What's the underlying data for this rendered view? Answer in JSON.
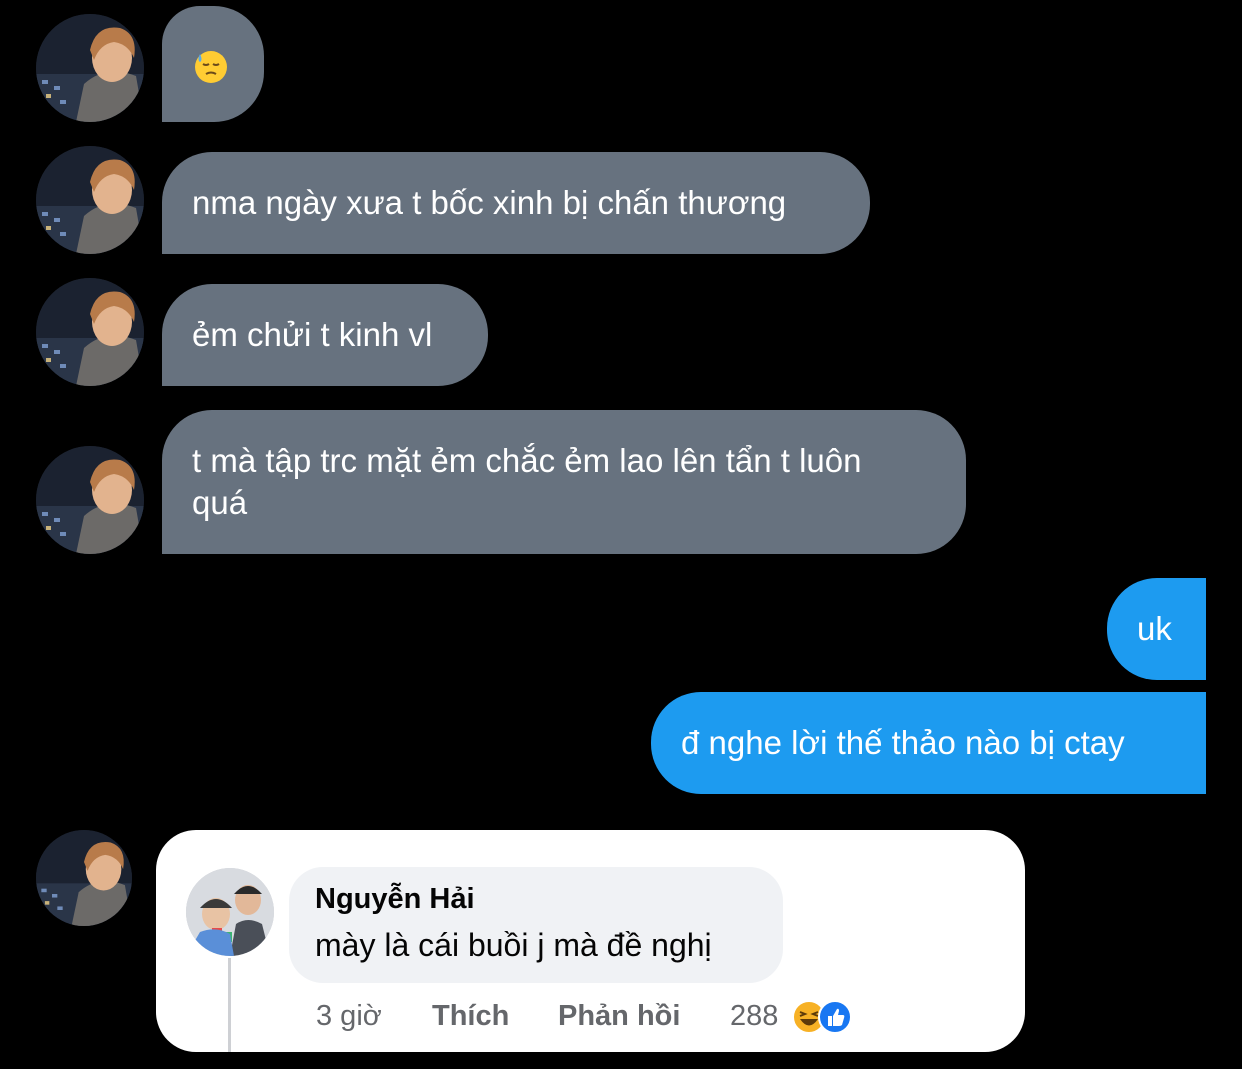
{
  "messages": {
    "incoming": [
      {
        "text": ""
      },
      {
        "text": "nma ngày xưa t bốc xinh bị chấn thương"
      },
      {
        "text": "ẻm chửi t kinh vl"
      },
      {
        "text": "t mà tập trc mặt ẻm chắc ẻm lao lên tẩn t luôn quá"
      }
    ],
    "outgoing": [
      {
        "text": "uk"
      },
      {
        "text": "đ nghe lời thế thảo nào bị ctay"
      }
    ]
  },
  "fb_comment": {
    "author": "Nguyễn Hải",
    "text": "mày là cái buồi j mà đề nghị",
    "time": "3 giờ",
    "like_label": "Thích",
    "reply_label": "Phản hồi",
    "reaction_count": "288"
  },
  "colors": {
    "background": "#000000",
    "incoming_bubble": "#67727f",
    "outgoing_bubble": "#1d9bf0"
  },
  "icons": {
    "emoji": "sweat-face-emoji",
    "reactions": [
      "haha-reaction-icon",
      "like-reaction-icon"
    ]
  }
}
